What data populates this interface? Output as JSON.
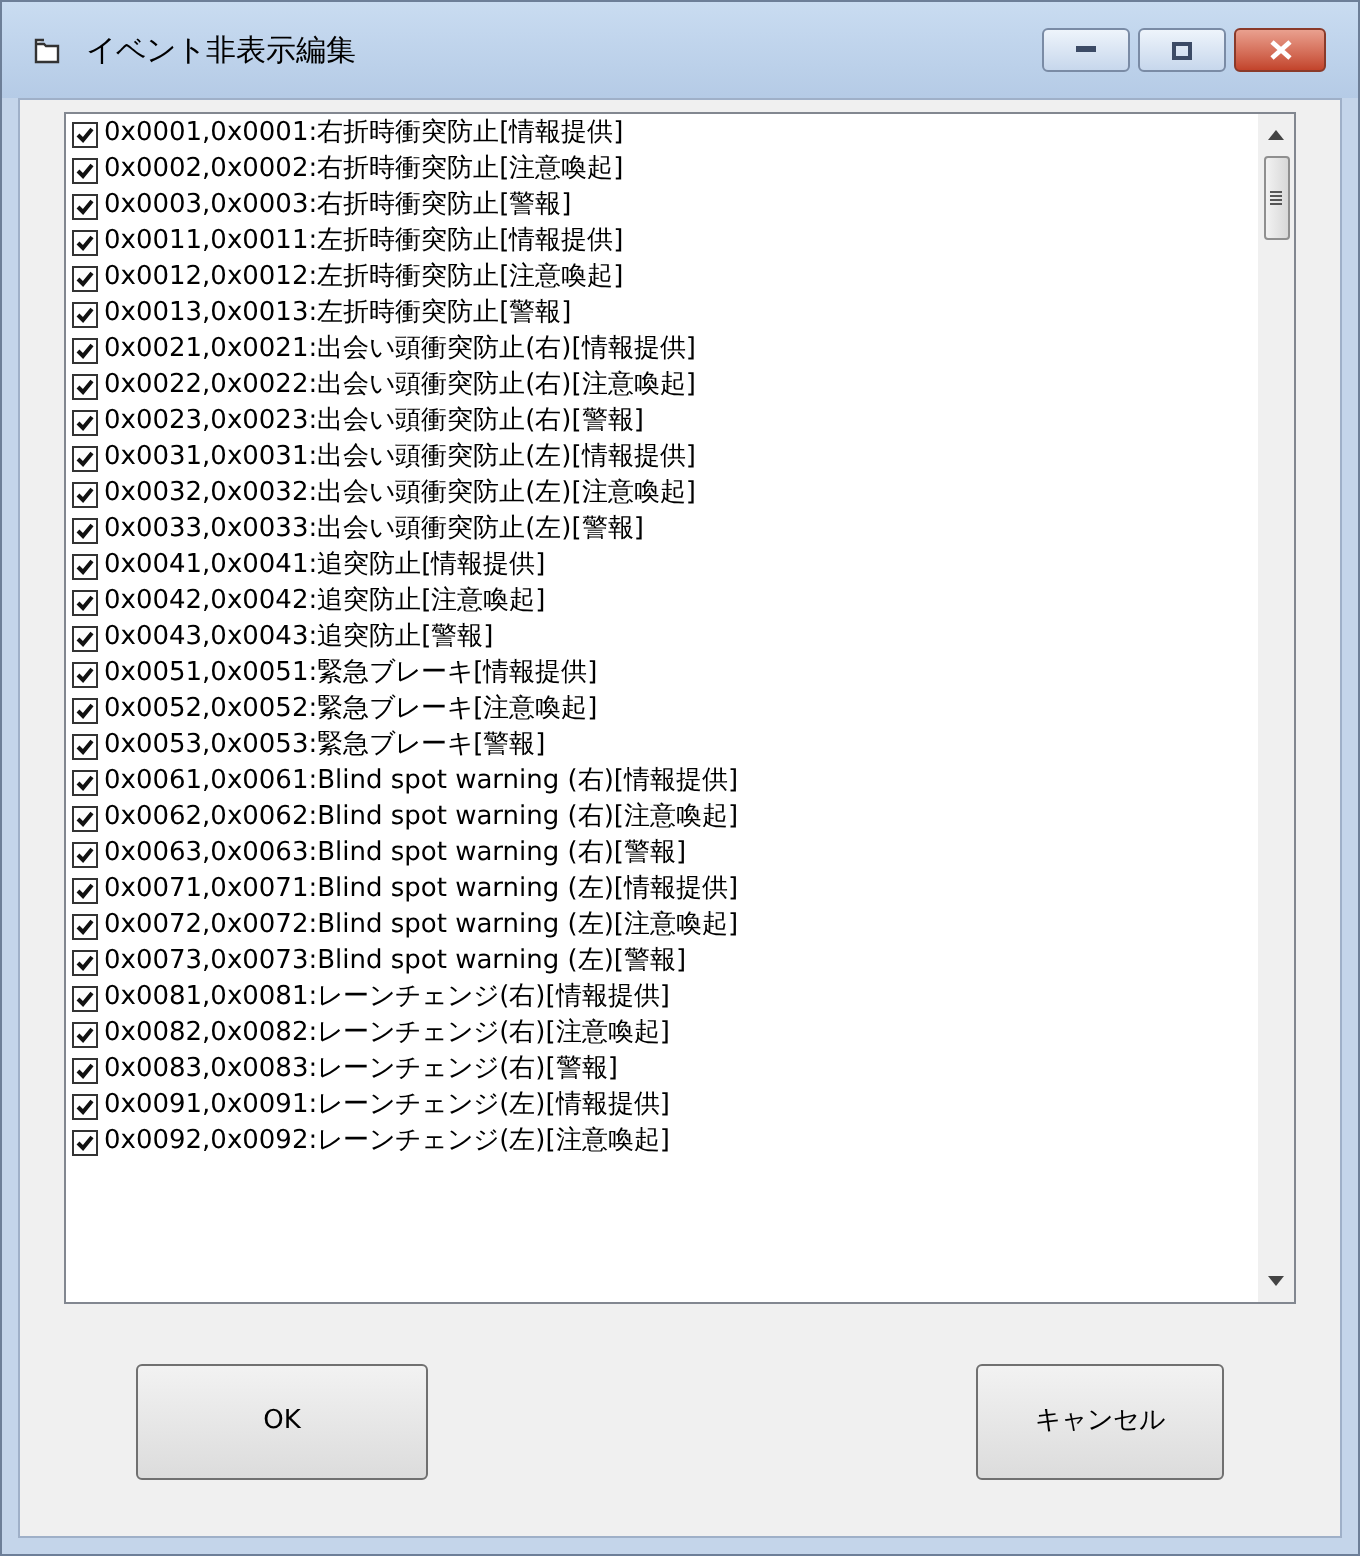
{
  "window": {
    "title": "イベント非表示編集"
  },
  "items": [
    {
      "label": "0x0001,0x0001:右折時衝突防止[情報提供]",
      "checked": true
    },
    {
      "label": "0x0002,0x0002:右折時衝突防止[注意喚起]",
      "checked": true
    },
    {
      "label": "0x0003,0x0003:右折時衝突防止[警報]",
      "checked": true
    },
    {
      "label": "0x0011,0x0011:左折時衝突防止[情報提供]",
      "checked": true
    },
    {
      "label": "0x0012,0x0012:左折時衝突防止[注意喚起]",
      "checked": true
    },
    {
      "label": "0x0013,0x0013:左折時衝突防止[警報]",
      "checked": true
    },
    {
      "label": "0x0021,0x0021:出会い頭衝突防止(右)[情報提供]",
      "checked": true
    },
    {
      "label": "0x0022,0x0022:出会い頭衝突防止(右)[注意喚起]",
      "checked": true
    },
    {
      "label": "0x0023,0x0023:出会い頭衝突防止(右)[警報]",
      "checked": true
    },
    {
      "label": "0x0031,0x0031:出会い頭衝突防止(左)[情報提供]",
      "checked": true
    },
    {
      "label": "0x0032,0x0032:出会い頭衝突防止(左)[注意喚起]",
      "checked": true
    },
    {
      "label": "0x0033,0x0033:出会い頭衝突防止(左)[警報]",
      "checked": true
    },
    {
      "label": "0x0041,0x0041:追突防止[情報提供]",
      "checked": true
    },
    {
      "label": "0x0042,0x0042:追突防止[注意喚起]",
      "checked": true
    },
    {
      "label": "0x0043,0x0043:追突防止[警報]",
      "checked": true
    },
    {
      "label": "0x0051,0x0051:緊急ブレーキ[情報提供]",
      "checked": true
    },
    {
      "label": "0x0052,0x0052:緊急ブレーキ[注意喚起]",
      "checked": true
    },
    {
      "label": "0x0053,0x0053:緊急ブレーキ[警報]",
      "checked": true
    },
    {
      "label": "0x0061,0x0061:Blind spot warning (右)[情報提供]",
      "checked": true
    },
    {
      "label": "0x0062,0x0062:Blind spot warning (右)[注意喚起]",
      "checked": true
    },
    {
      "label": "0x0063,0x0063:Blind spot warning (右)[警報]",
      "checked": true
    },
    {
      "label": "0x0071,0x0071:Blind spot warning (左)[情報提供]",
      "checked": true
    },
    {
      "label": "0x0072,0x0072:Blind spot warning (左)[注意喚起]",
      "checked": true
    },
    {
      "label": "0x0073,0x0073:Blind spot warning (左)[警報]",
      "checked": true
    },
    {
      "label": "0x0081,0x0081:レーンチェンジ(右)[情報提供]",
      "checked": true
    },
    {
      "label": "0x0082,0x0082:レーンチェンジ(右)[注意喚起]",
      "checked": true
    },
    {
      "label": "0x0083,0x0083:レーンチェンジ(右)[警報]",
      "checked": true
    },
    {
      "label": "0x0091,0x0091:レーンチェンジ(左)[情報提供]",
      "checked": true
    },
    {
      "label": "0x0092,0x0092:レーンチェンジ(左)[注意喚起]",
      "checked": true
    }
  ],
  "buttons": [
    "OK",
    "キャンセル"
  ]
}
